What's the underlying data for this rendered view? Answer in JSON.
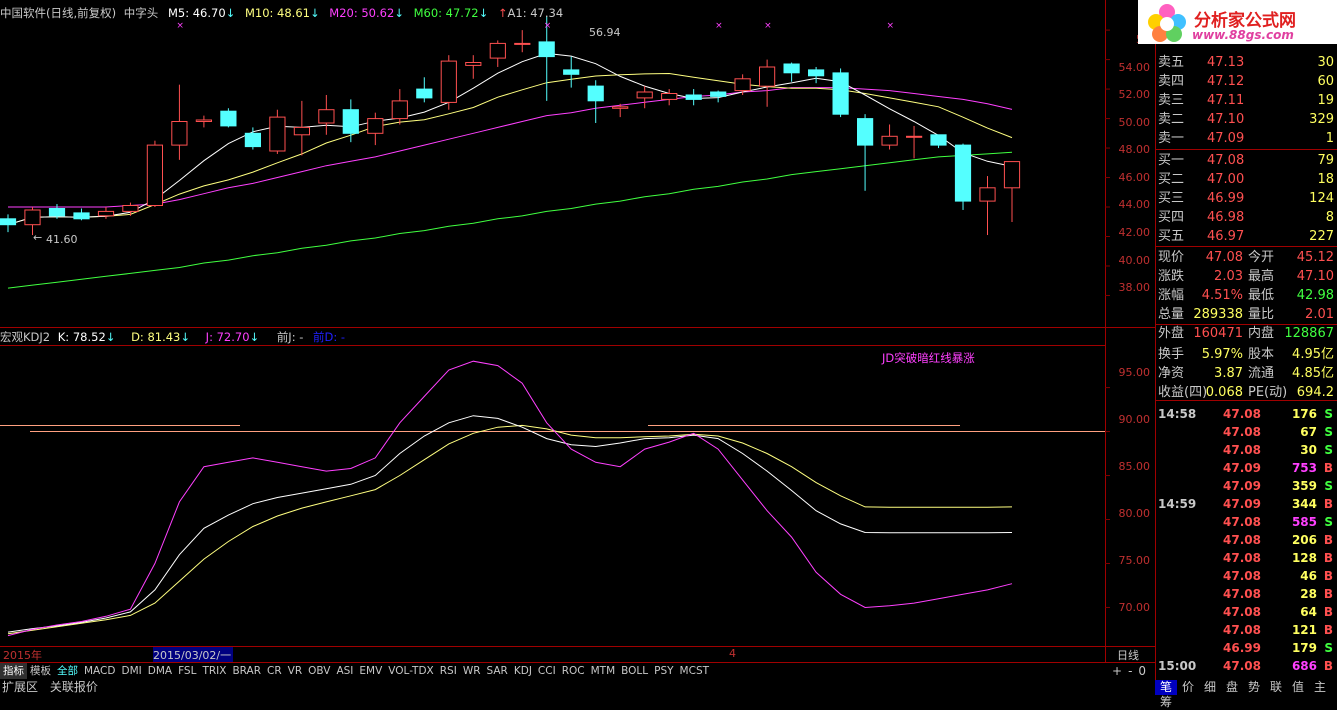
{
  "header": {
    "title": "中国软件(日线,前复权)",
    "pattern": "中字头",
    "ma5": "M5: 46.70",
    "ma10": "M10: 48.61",
    "ma20": "M20: 50.62",
    "ma60": "M60: 47.72",
    "a1": "A1: 47.34",
    "ma5_arrow": "↓",
    "ma10_arrow": "↓",
    "ma20_arrow": "↓",
    "ma60_arrow": "↓",
    "a1_arrow": "↑"
  },
  "indicator_header": {
    "name": "宏观KDJ2",
    "k": "K: 78.52",
    "d": "D: 81.43",
    "j": "J: 72.70",
    "k_arrow": "↓",
    "d_arrow": "↓",
    "j_arrow": "↓",
    "prev_j": "前J: -",
    "prev_d": "前D: -"
  },
  "annotation": "JD突破暗红线暴涨",
  "price_markers": {
    "high": "56.94",
    "low": "41.60"
  },
  "price_axis": [
    "56",
    "54.00",
    "52.00",
    "50.00",
    "48.00",
    "46.00",
    "44.00",
    "42.00",
    "40.00",
    "38.00"
  ],
  "kdj_axis": [
    "95.00",
    "90.00",
    "85.00",
    "80.00",
    "75.00",
    "70.00"
  ],
  "date_bar": {
    "year": "2015年",
    "cursor_date": "2015/03/02/一",
    "marker": "4",
    "period": "日线",
    "buttons": [
      "+",
      "-",
      "0"
    ]
  },
  "tabs": [
    "指标",
    "模板",
    "全部",
    "MACD",
    "DMI",
    "DMA",
    "FSL",
    "TRIX",
    "BRAR",
    "CR",
    "VR",
    "OBV",
    "ASI",
    "EMV",
    "VOL-TDX",
    "RSI",
    "WR",
    "SAR",
    "KDJ",
    "CCI",
    "ROC",
    "MTM",
    "BOLL",
    "PSY",
    "MCST"
  ],
  "bottom_links": [
    "扩展区",
    "关联报价"
  ],
  "logo": {
    "title": "分析家公式网",
    "url": "www.88gs.com"
  },
  "order_book": {
    "asks": [
      {
        "label": "卖五",
        "price": "47.13",
        "vol": "30"
      },
      {
        "label": "卖四",
        "price": "47.12",
        "vol": "60"
      },
      {
        "label": "卖三",
        "price": "47.11",
        "vol": "19"
      },
      {
        "label": "卖二",
        "price": "47.10",
        "vol": "329"
      },
      {
        "label": "卖一",
        "price": "47.09",
        "vol": "1"
      }
    ],
    "bids": [
      {
        "label": "买一",
        "price": "47.08",
        "vol": "79"
      },
      {
        "label": "买二",
        "price": "47.00",
        "vol": "18"
      },
      {
        "label": "买三",
        "price": "46.99",
        "vol": "124"
      },
      {
        "label": "买四",
        "price": "46.98",
        "vol": "8"
      },
      {
        "label": "买五",
        "price": "46.97",
        "vol": "227"
      }
    ]
  },
  "quote": [
    {
      "l1": "现价",
      "v1": "47.08",
      "l2": "今开",
      "v2": "45.12"
    },
    {
      "l1": "涨跌",
      "v1": "2.03",
      "l2": "最高",
      "v2": "47.10"
    },
    {
      "l1": "涨幅",
      "v1": "4.51%",
      "l2": "最低",
      "v2": "42.98"
    },
    {
      "l1": "总量",
      "v1": "289338",
      "l2": "量比",
      "v2": "2.01"
    },
    {
      "l1": "外盘",
      "v1": "160471",
      "l2": "内盘",
      "v2": "128867"
    },
    {
      "l1": "换手",
      "v1": "5.97%",
      "l2": "股本",
      "v2": "4.95亿"
    },
    {
      "l1": "净资",
      "v1": "3.87",
      "l2": "流通",
      "v2": "4.85亿"
    },
    {
      "l1": "收益(四)",
      "v1": "0.068",
      "l2": "PE(动)",
      "v2": "694.2"
    }
  ],
  "ticks": [
    {
      "time": "14:58",
      "price": "47.08",
      "vol": "176",
      "side": "S"
    },
    {
      "time": "",
      "price": "47.08",
      "vol": "67",
      "side": "S"
    },
    {
      "time": "",
      "price": "47.08",
      "vol": "30",
      "side": "S"
    },
    {
      "time": "",
      "price": "47.09",
      "vol": "753",
      "side": "B"
    },
    {
      "time": "",
      "price": "47.09",
      "vol": "359",
      "side": "S"
    },
    {
      "time": "14:59",
      "price": "47.09",
      "vol": "344",
      "side": "B"
    },
    {
      "time": "",
      "price": "47.08",
      "vol": "585",
      "side": "S"
    },
    {
      "time": "",
      "price": "47.08",
      "vol": "206",
      "side": "B"
    },
    {
      "time": "",
      "price": "47.08",
      "vol": "128",
      "side": "B"
    },
    {
      "time": "",
      "price": "47.08",
      "vol": "46",
      "side": "B"
    },
    {
      "time": "",
      "price": "47.08",
      "vol": "28",
      "side": "B"
    },
    {
      "time": "",
      "price": "47.08",
      "vol": "64",
      "side": "B"
    },
    {
      "time": "",
      "price": "47.08",
      "vol": "121",
      "side": "B"
    },
    {
      "time": "",
      "price": "46.99",
      "vol": "179",
      "side": "S"
    },
    {
      "time": "15:00",
      "price": "47.08",
      "vol": "686",
      "side": "B"
    }
  ],
  "nav_tabs": [
    "笔",
    "价",
    "细",
    "盘",
    "势",
    "联",
    "值",
    "主",
    "筹"
  ],
  "colors": {
    "up": "#ff5050",
    "down": "#54ffff",
    "ma5": "#ffffff",
    "ma10": "#ffff80",
    "ma20": "#ff40ff",
    "ma60": "#40ff40",
    "grid": "#800000",
    "ref_line": "#ffa080"
  },
  "chart_data": {
    "type": "candlestick",
    "candles": [
      [
        43.2,
        43.5,
        42.3,
        42.8
      ],
      [
        42.8,
        44.0,
        42.1,
        43.8
      ],
      [
        43.9,
        44.2,
        43.2,
        43.4
      ],
      [
        43.6,
        43.9,
        43.1,
        43.2
      ],
      [
        43.4,
        44.0,
        43.2,
        43.7
      ],
      [
        43.7,
        44.3,
        43.4,
        44.1
      ],
      [
        44.1,
        48.5,
        44.0,
        48.2
      ],
      [
        48.2,
        52.3,
        47.2,
        49.8
      ],
      [
        49.8,
        50.2,
        49.4,
        49.9
      ],
      [
        50.5,
        50.7,
        49.4,
        49.5
      ],
      [
        49.0,
        49.4,
        47.9,
        48.1
      ],
      [
        47.8,
        50.6,
        47.6,
        50.1
      ],
      [
        48.9,
        51.2,
        47.5,
        49.4
      ],
      [
        49.7,
        51.6,
        48.9,
        50.6
      ],
      [
        50.6,
        51.3,
        48.4,
        49.0
      ],
      [
        49.0,
        50.4,
        48.2,
        50.0
      ],
      [
        50.0,
        52.0,
        49.6,
        51.2
      ],
      [
        52.0,
        52.8,
        51.1,
        51.4
      ],
      [
        51.1,
        54.3,
        50.6,
        53.9
      ],
      [
        53.6,
        54.3,
        52.7,
        53.8
      ],
      [
        54.1,
        55.3,
        53.5,
        55.1
      ],
      [
        55.1,
        56.0,
        54.5,
        55.1
      ],
      [
        55.2,
        56.94,
        51.2,
        54.2
      ],
      [
        53.3,
        54.2,
        52.1,
        53.0
      ],
      [
        52.2,
        52.6,
        49.7,
        51.2
      ],
      [
        50.7,
        51.0,
        50.1,
        50.8
      ],
      [
        51.4,
        52.2,
        50.7,
        51.8
      ],
      [
        51.3,
        52.0,
        50.9,
        51.7
      ],
      [
        51.6,
        52.0,
        50.9,
        51.3
      ],
      [
        51.8,
        51.9,
        51.1,
        51.5
      ],
      [
        51.9,
        53.0,
        51.6,
        52.7
      ],
      [
        52.2,
        54.0,
        50.8,
        53.5
      ],
      [
        53.7,
        53.8,
        52.5,
        53.1
      ],
      [
        53.3,
        53.5,
        52.4,
        52.9
      ],
      [
        53.1,
        53.4,
        50.1,
        50.3
      ],
      [
        50.0,
        50.3,
        45.1,
        48.2
      ],
      [
        48.2,
        49.6,
        47.9,
        48.8
      ],
      [
        48.8,
        49.5,
        47.3,
        48.8
      ],
      [
        48.9,
        48.9,
        48.0,
        48.2
      ],
      [
        48.2,
        48.3,
        43.8,
        44.4
      ],
      [
        44.4,
        46.1,
        42.1,
        45.3
      ],
      [
        45.3,
        47.1,
        42.98,
        47.08
      ]
    ],
    "ma20": [
      44.0,
      44.0,
      44.0,
      44.0,
      44.0,
      44.1,
      44.2,
      44.5,
      44.9,
      45.3,
      45.6,
      46.0,
      46.4,
      46.8,
      47.1,
      47.4,
      47.8,
      48.2,
      48.6,
      49.0,
      49.4,
      49.8,
      50.2,
      50.4,
      50.7,
      50.9,
      51.1,
      51.3,
      51.5,
      51.6,
      51.8,
      51.9,
      52.1,
      52.1,
      52.1,
      52.0,
      51.9,
      51.7,
      51.5,
      51.3,
      51.0,
      50.62
    ],
    "ma60": [
      38.5,
      38.7,
      38.9,
      39.1,
      39.3,
      39.5,
      39.7,
      39.9,
      40.2,
      40.4,
      40.7,
      40.9,
      41.2,
      41.4,
      41.7,
      41.9,
      42.2,
      42.4,
      42.7,
      42.9,
      43.2,
      43.4,
      43.7,
      43.9,
      44.2,
      44.4,
      44.7,
      44.9,
      45.2,
      45.4,
      45.7,
      45.9,
      46.2,
      46.4,
      46.6,
      46.8,
      47.0,
      47.2,
      47.4,
      47.5,
      47.6,
      47.72
    ],
    "kdj_j": [
      66.8,
      67.5,
      68.0,
      68.4,
      69.0,
      69.8,
      75.0,
      82.0,
      86.0,
      86.5,
      87.0,
      86.5,
      86.0,
      85.5,
      85.8,
      87.0,
      91.0,
      94.0,
      97.0,
      98.0,
      97.5,
      95.5,
      91.0,
      88.0,
      86.5,
      86.0,
      88.0,
      88.8,
      89.8,
      88.0,
      84.5,
      81.0,
      78.0,
      74.0,
      71.5,
      70.0,
      70.2,
      70.5,
      71.0,
      71.5,
      72.0,
      72.7
    ],
    "kdj_k": [
      67.2,
      67.6,
      67.9,
      68.3,
      68.8,
      69.5,
      72.0,
      76.0,
      79.0,
      80.5,
      81.8,
      82.5,
      83.0,
      83.5,
      84.0,
      85.0,
      87.5,
      89.5,
      91.0,
      91.8,
      91.5,
      90.5,
      89.2,
      88.5,
      88.3,
      88.7,
      89.2,
      89.3,
      89.6,
      89.2,
      87.5,
      85.5,
      83.3,
      81.0,
      79.5,
      78.52,
      78.5,
      78.5,
      78.5,
      78.5,
      78.5,
      78.52
    ],
    "kdj_d": [
      67.0,
      67.4,
      67.8,
      68.2,
      68.6,
      69.1,
      70.5,
      73.0,
      75.5,
      77.5,
      79.2,
      80.4,
      81.3,
      82.0,
      82.7,
      83.4,
      85.0,
      86.8,
      88.6,
      89.8,
      90.5,
      90.7,
      90.3,
      89.6,
      89.3,
      89.3,
      89.4,
      89.5,
      89.7,
      89.5,
      88.7,
      87.5,
      86.0,
      84.2,
      82.7,
      81.43,
      81.4,
      81.4,
      81.4,
      81.4,
      81.4,
      81.43
    ],
    "kdj_threshold": 90,
    "price_range": [
      36.2,
      57.5
    ],
    "kdj_range": [
      66.3,
      99.5
    ]
  }
}
